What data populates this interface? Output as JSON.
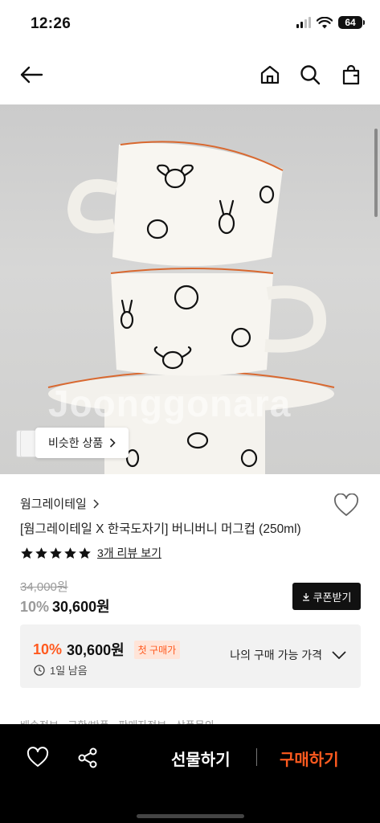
{
  "status_bar": {
    "time": "12:26",
    "battery": "64"
  },
  "nav": {
    "back_icon": "arrow-left-icon",
    "home_icon": "home-icon",
    "search_icon": "search-icon",
    "cart_icon": "shopping-bag-icon"
  },
  "product": {
    "watermark": "Joonggonara",
    "similar_label": "비슷한 상품",
    "brand": "웜그레이테일",
    "title": "[웜그레이테일 X 한국도자기] 버니버니 머그컵 (250ml)",
    "rating_stars": 5,
    "review_link": "3개 리뷰 보기",
    "original_price": "34,000원",
    "discount": "10%",
    "price": "30,600원",
    "coupon_label": "쿠폰받기"
  },
  "offer": {
    "discount": "10%",
    "price": "30,600원",
    "badge": "첫 구매가",
    "time_left": "1일 남음",
    "toggle_label": "나의 구매 가능 가격"
  },
  "partial_text": "배송정보 · 교환/반품 · 판매자정보 · 상품문의",
  "bottom_bar": {
    "gift_label": "선물하기",
    "buy_label": "구매하기",
    "accent_color": "#ff5a1f"
  }
}
